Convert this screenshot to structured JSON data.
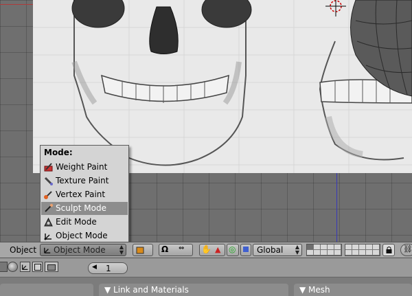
{
  "mode_menu": {
    "title": "Mode:",
    "items": [
      {
        "label": "Weight Paint",
        "icon": "weight-paint-icon",
        "highlighted": false
      },
      {
        "label": "Texture Paint",
        "icon": "texture-paint-icon",
        "highlighted": false
      },
      {
        "label": "Vertex Paint",
        "icon": "vertex-paint-icon",
        "highlighted": false
      },
      {
        "label": "Sculpt Mode",
        "icon": "sculpt-mode-icon",
        "highlighted": true
      },
      {
        "label": "Edit Mode",
        "icon": "edit-mode-icon",
        "highlighted": false
      },
      {
        "label": "Object Mode",
        "icon": "object-mode-icon",
        "highlighted": false
      }
    ]
  },
  "header": {
    "menu_label": "Object",
    "mode_value": "Object Mode",
    "orientation_value": "Global"
  },
  "timeline": {
    "frame": "1"
  },
  "panels": {
    "tab1": "Link and Materials",
    "tab2": "Mesh"
  },
  "colors": {
    "highlight": "#8d8d8d",
    "menu_bg": "#d4d4d4",
    "header_bg": "#a7a7a7"
  }
}
